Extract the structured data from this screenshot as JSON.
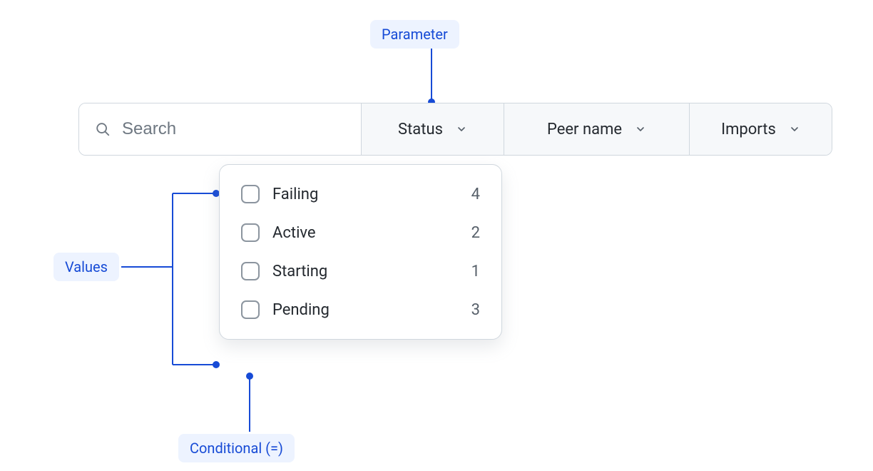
{
  "annotations": {
    "parameter": "Parameter",
    "values": "Values",
    "conditional": "Conditional (=)"
  },
  "search": {
    "placeholder": "Search"
  },
  "filters": {
    "status": {
      "label": "Status"
    },
    "peername": {
      "label": "Peer name"
    },
    "imports": {
      "label": "Imports"
    }
  },
  "status_options": [
    {
      "label": "Failing",
      "count": "4"
    },
    {
      "label": "Active",
      "count": "2"
    },
    {
      "label": "Starting",
      "count": "1"
    },
    {
      "label": "Pending",
      "count": "3"
    }
  ],
  "colors": {
    "anno_bg": "#edf3ff",
    "anno_fg": "#174bd6",
    "border": "#d0d7de",
    "panel": "#f6f8fa"
  }
}
